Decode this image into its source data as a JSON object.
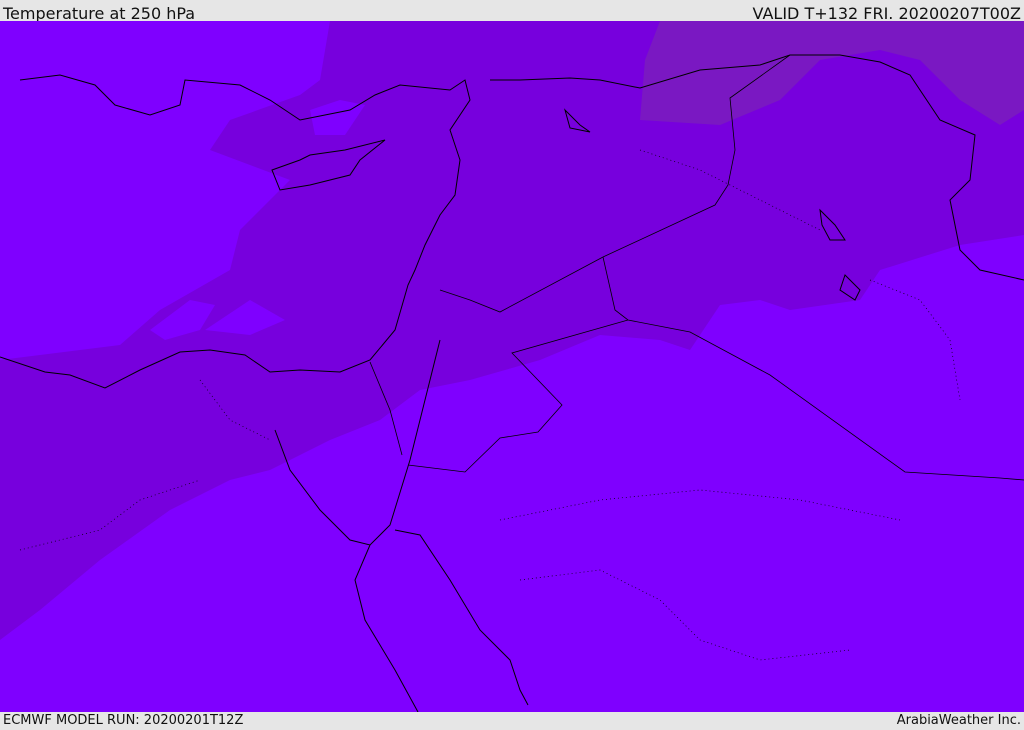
{
  "header": {
    "title": "Temperature at 250 hPa",
    "valid": "VALID T+132 FRI. 20200207T00Z"
  },
  "footer": {
    "model_run": "ECMWF MODEL RUN: 20200201T12Z",
    "credit": "ArabiaWeather Inc."
  },
  "colors": {
    "level_warm": "#7f00ff",
    "level_mid": "#7700dd",
    "level_cold": "#7a18c2",
    "coastline": "#000000"
  }
}
